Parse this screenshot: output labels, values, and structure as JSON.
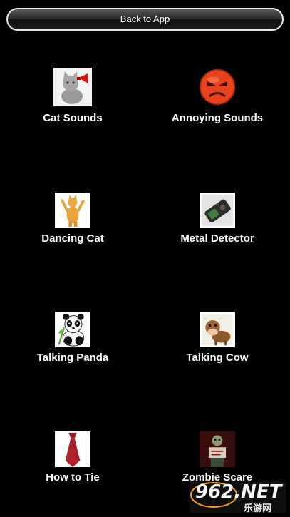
{
  "header": {
    "back_label": "Back to App"
  },
  "tiles": [
    {
      "label": "Cat Sounds",
      "icon": "cat-icon"
    },
    {
      "label": "Annoying Sounds",
      "icon": "angry-face-icon"
    },
    {
      "label": "Dancing Cat",
      "icon": "dancing-cat-icon"
    },
    {
      "label": "Metal Detector",
      "icon": "metal-detector-icon"
    },
    {
      "label": "Talking Panda",
      "icon": "panda-icon"
    },
    {
      "label": "Talking Cow",
      "icon": "cow-icon"
    },
    {
      "label": "How to Tie",
      "icon": "necktie-icon"
    },
    {
      "label": "Zombie Scare",
      "icon": "zombie-icon"
    }
  ],
  "watermark": {
    "main": "962.NET",
    "sub": "乐游网"
  }
}
